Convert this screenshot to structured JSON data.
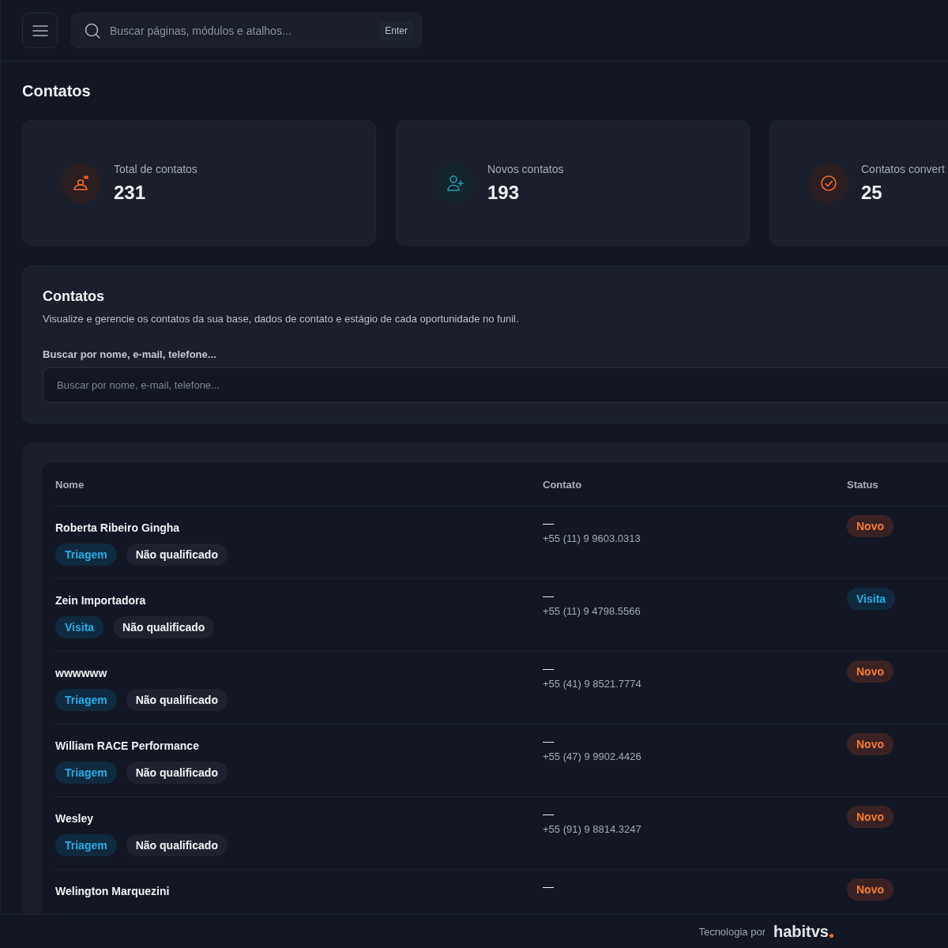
{
  "top_bar": {
    "search": {
      "placeholder": "Buscar páginas, módulos e atalhos...",
      "shortcut": "Enter"
    }
  },
  "page_title": "Contatos",
  "stats": [
    {
      "label": "Total de contatos",
      "value": "231",
      "kind": "total"
    },
    {
      "label": "Novos contatos",
      "value": "193",
      "kind": "new"
    },
    {
      "label": "Contatos convert",
      "value": "25",
      "kind": "converted"
    }
  ],
  "filter_panel": {
    "title": "Contatos",
    "description": "Visualize e gerencie os contatos da sua base, dados de contato e estágio de cada oportunidade no funil.",
    "field_label": "Buscar por nome, e-mail, telefone...",
    "placeholder": "Buscar por nome, e-mail, telefone..."
  },
  "table": {
    "columns": [
      "Nome",
      "Contato",
      "Status"
    ],
    "rows": [
      {
        "name": "Roberta Ribeiro Gingha",
        "tags": [
          {
            "label": "Triagem",
            "kind": "stage"
          },
          {
            "label": "Não qualificado",
            "kind": "qualification"
          }
        ],
        "email": "—",
        "phone": "+55 (11) 9 9603.0313",
        "status": {
          "label": "Novo",
          "kind": "new"
        }
      },
      {
        "name": "Zein Importadora",
        "tags": [
          {
            "label": "Visita",
            "kind": "stage"
          },
          {
            "label": "Não qualificado",
            "kind": "qualification"
          }
        ],
        "email": "—",
        "phone": "+55 (11) 9 4798.5566",
        "status": {
          "label": "Visita",
          "kind": "visit"
        }
      },
      {
        "name": "wwwwww",
        "tags": [
          {
            "label": "Triagem",
            "kind": "stage"
          },
          {
            "label": "Não qualificado",
            "kind": "qualification"
          }
        ],
        "email": "—",
        "phone": "+55 (41) 9 8521.7774",
        "status": {
          "label": "Novo",
          "kind": "new"
        }
      },
      {
        "name": "William RACE Performance",
        "tags": [
          {
            "label": "Triagem",
            "kind": "stage"
          },
          {
            "label": "Não qualificado",
            "kind": "qualification"
          }
        ],
        "email": "—",
        "phone": "+55 (47) 9 9902.4426",
        "status": {
          "label": "Novo",
          "kind": "new"
        }
      },
      {
        "name": "Wesley",
        "tags": [
          {
            "label": "Triagem",
            "kind": "stage"
          },
          {
            "label": "Não qualificado",
            "kind": "qualification"
          }
        ],
        "email": "—",
        "phone": "+55 (91) 9 8814.3247",
        "status": {
          "label": "Novo",
          "kind": "new"
        }
      },
      {
        "name": "Welington Marquezini",
        "email": "—",
        "status": {
          "label": "Novo",
          "kind": "new"
        }
      }
    ]
  },
  "footer": {
    "text": "Tecnologia por",
    "brand": "habitvs"
  }
}
